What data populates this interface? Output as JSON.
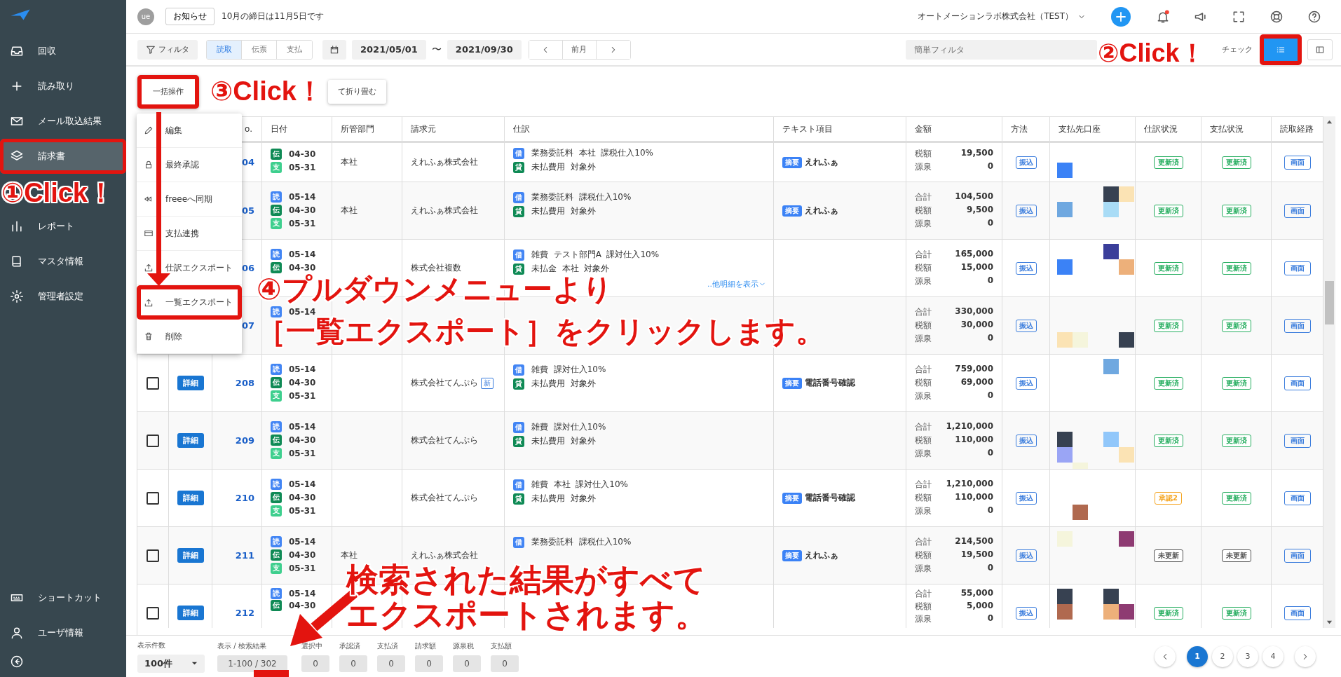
{
  "sidebar": {
    "items": [
      {
        "label": "回収",
        "selected": false,
        "highlighted": false
      },
      {
        "label": "読み取り",
        "selected": false,
        "highlighted": false
      },
      {
        "label": "メール取込結果",
        "selected": false,
        "highlighted": false
      },
      {
        "label": "請求書",
        "selected": true,
        "highlighted": true
      },
      {
        "label": "レポート",
        "selected": false,
        "highlighted": false
      },
      {
        "label": "マスタ情報",
        "selected": false,
        "highlighted": false
      },
      {
        "label": "管理者設定",
        "selected": false,
        "highlighted": false
      }
    ],
    "bottom_items": [
      {
        "label": "ショートカット"
      },
      {
        "label": "ユーザ情報"
      }
    ]
  },
  "topbar": {
    "avatar": "ue",
    "notice_button": "お知らせ",
    "notice": "10月の締日は11月5日です",
    "company": "オートメーションラボ株式会社（TEST）",
    "unread": true
  },
  "toolbar": {
    "filter_button": "フィルタ",
    "source_tabs": [
      {
        "label": "読取",
        "selected": true
      },
      {
        "label": "伝票",
        "selected": false
      },
      {
        "label": "支払",
        "selected": false
      }
    ],
    "date_from": "2021/05/01",
    "date_separator": "〜",
    "date_to": "2021/09/30",
    "month_button": "前月",
    "quick_filter": {
      "placeholder": "簡単フィルタ"
    },
    "check_button": "チェック",
    "view_toggles": [
      {
        "selected": true,
        "highlighted": true
      },
      {
        "selected": false,
        "highlighted": false
      }
    ]
  },
  "bulk_buttons": [
    {
      "label": "一括操作",
      "highlighted": true
    },
    {
      "label": "て折り畳む",
      "highlighted": false
    }
  ],
  "dropdown_menu": {
    "items": [
      {
        "label": "編集",
        "highlighted": false
      },
      {
        "label": "最終承認",
        "highlighted": false
      },
      {
        "label": "freeeへ同期",
        "highlighted": false
      },
      {
        "label": "支払連携",
        "highlighted": false
      },
      {
        "label": "仕訳エクスポート",
        "highlighted": false
      },
      {
        "label": "一覧エクスポート",
        "highlighted": true
      },
      {
        "label": "削除",
        "highlighted": false
      }
    ]
  },
  "table": {
    "columns": [
      "o.",
      "日付",
      "所管部門",
      "請求元",
      "仕訳",
      "テキスト項目",
      "金額",
      "方法",
      "支払先口座",
      "仕訳状況",
      "支払状況",
      "読取経路"
    ],
    "rows": [
      {
        "no": "04",
        "dates": [
          {
            "tag": "伝",
            "color": "#0f8a55",
            "date": "04-30"
          },
          {
            "tag": "支",
            "color": "#3ecf8e",
            "date": "05-31"
          }
        ],
        "dept": "本社",
        "client": "えれふぁ株式会社",
        "journal": [
          {
            "side": "借",
            "color": "#4285f4",
            "text": "業務委託料  本社  課税仕入10%"
          },
          {
            "side": "貸",
            "color": "#0f8a55",
            "text": "未払費用  対象外"
          }
        ],
        "summary": {
          "tag": "摘要",
          "text": "えれふぁ"
        },
        "amounts": [
          {
            "label": "税額",
            "value": "19,500"
          },
          {
            "label": "源泉",
            "value": "0"
          }
        ],
        "method": "振込",
        "journal_status": {
          "text": "更新済",
          "color": "#27ae60"
        },
        "pay_status": {
          "text": "更新済",
          "color": "#27ae60"
        },
        "route": "画面"
      },
      {
        "no": "05",
        "dates": [
          {
            "tag": "読",
            "color": "#4285f4",
            "date": "05-14"
          },
          {
            "tag": "伝",
            "color": "#0f8a55",
            "date": "04-30"
          },
          {
            "tag": "支",
            "color": "#3ecf8e",
            "date": "05-31"
          }
        ],
        "dept": "本社",
        "client": "えれふぁ株式会社",
        "journal": [
          {
            "side": "借",
            "color": "#4285f4",
            "text": "業務委託料  課税仕入10%"
          },
          {
            "side": "貸",
            "color": "#0f8a55",
            "text": "未払費用  対象外"
          }
        ],
        "summary": {
          "tag": "摘要",
          "text": "えれふぁ"
        },
        "amounts": [
          {
            "label": "合計",
            "value": "104,500"
          },
          {
            "label": "税額",
            "value": "9,500"
          },
          {
            "label": "源泉",
            "value": "0"
          }
        ],
        "method": "振込",
        "journal_status": {
          "text": "更新済",
          "color": "#27ae60"
        },
        "pay_status": {
          "text": "更新済",
          "color": "#27ae60"
        },
        "route": "画面"
      },
      {
        "no": "06",
        "dates": [
          {
            "tag": "読",
            "color": "#4285f4",
            "date": "05-14"
          },
          {
            "tag": "伝",
            "color": "#0f8a55",
            "date": "04-30"
          }
        ],
        "client": "株式会社複数",
        "journal": [
          {
            "side": "借",
            "color": "#4285f4",
            "text": "雑費  テスト部門A  課対仕入10%"
          },
          {
            "side": "貸",
            "color": "#0f8a55",
            "text": "未払金  本社  対象外"
          }
        ],
        "more_link": "..他明細を表示",
        "amounts": [
          {
            "label": "合計",
            "value": "165,000"
          },
          {
            "label": "税額",
            "value": "15,000"
          },
          {
            "label": "源泉",
            "value": "0"
          }
        ],
        "method": "振込",
        "journal_status": {
          "text": "更新済",
          "color": "#27ae60"
        },
        "pay_status": {
          "text": "更新済",
          "color": "#27ae60"
        },
        "route": "画面"
      },
      {
        "no": "07",
        "dates": [
          {
            "tag": "読",
            "color": "#4285f4",
            "date": "05-14"
          }
        ],
        "amounts": [
          {
            "label": "合計",
            "value": "330,000"
          },
          {
            "label": "税額",
            "value": "30,000"
          },
          {
            "label": "源泉",
            "value": "0"
          }
        ],
        "method": "振込",
        "journal_status": {
          "text": "更新済",
          "color": "#27ae60"
        },
        "pay_status": {
          "text": "更新済",
          "color": "#27ae60"
        },
        "route": "画面"
      },
      {
        "checked": false,
        "detail": "詳細",
        "no": "208",
        "dates": [
          {
            "tag": "読",
            "color": "#4285f4",
            "date": "05-14"
          },
          {
            "tag": "伝",
            "color": "#0f8a55",
            "date": "04-30"
          },
          {
            "tag": "支",
            "color": "#3ecf8e",
            "date": "05-31"
          }
        ],
        "client": "株式会社てんぷら",
        "client_badge": "新",
        "journal": [
          {
            "side": "借",
            "color": "#4285f4",
            "text": "雑費  課対仕入10%"
          },
          {
            "side": "貸",
            "color": "#0f8a55",
            "text": "未払費用  対象外"
          }
        ],
        "summary": {
          "tag": "摘要",
          "text": "電話番号確認"
        },
        "amounts": [
          {
            "label": "合計",
            "value": "759,000"
          },
          {
            "label": "税額",
            "value": "69,000"
          },
          {
            "label": "源泉",
            "value": "0"
          }
        ],
        "method": "振込",
        "journal_status": {
          "text": "更新済",
          "color": "#27ae60"
        },
        "pay_status": {
          "text": "更新済",
          "color": "#27ae60"
        },
        "route": "画面"
      },
      {
        "checked": false,
        "detail": "詳細",
        "no": "209",
        "dates": [
          {
            "tag": "読",
            "color": "#4285f4",
            "date": "05-14"
          },
          {
            "tag": "伝",
            "color": "#0f8a55",
            "date": "04-30"
          },
          {
            "tag": "支",
            "color": "#3ecf8e",
            "date": "05-31"
          }
        ],
        "client": "株式会社てんぷら",
        "journal": [
          {
            "side": "借",
            "color": "#4285f4",
            "text": "雑費  課対仕入10%"
          },
          {
            "side": "貸",
            "color": "#0f8a55",
            "text": "未払費用  対象外"
          }
        ],
        "amounts": [
          {
            "label": "合計",
            "value": "1,210,000"
          },
          {
            "label": "税額",
            "value": "110,000"
          },
          {
            "label": "源泉",
            "value": "0"
          }
        ],
        "method": "振込",
        "journal_status": {
          "text": "更新済",
          "color": "#27ae60"
        },
        "pay_status": {
          "text": "更新済",
          "color": "#27ae60"
        },
        "route": "画面"
      },
      {
        "checked": false,
        "detail": "詳細",
        "no": "210",
        "dates": [
          {
            "tag": "読",
            "color": "#4285f4",
            "date": "05-14"
          },
          {
            "tag": "伝",
            "color": "#0f8a55",
            "date": "04-30"
          },
          {
            "tag": "支",
            "color": "#3ecf8e",
            "date": "05-31"
          }
        ],
        "client": "株式会社てんぷら",
        "journal": [
          {
            "side": "借",
            "color": "#4285f4",
            "text": "雑費  本社  課対仕入10%"
          },
          {
            "side": "貸",
            "color": "#0f8a55",
            "text": "未払費用  対象外"
          }
        ],
        "summary": {
          "tag": "摘要",
          "text": "電話番号確認"
        },
        "amounts": [
          {
            "label": "合計",
            "value": "1,210,000"
          },
          {
            "label": "税額",
            "value": "110,000"
          },
          {
            "label": "源泉",
            "value": "0"
          }
        ],
        "method": "振込",
        "journal_status": {
          "text": "承認2",
          "color": "#f5a623"
        },
        "pay_status": {
          "text": "更新済",
          "color": "#27ae60"
        },
        "route": "画面"
      },
      {
        "checked": false,
        "detail": "詳細",
        "no": "211",
        "dates": [
          {
            "tag": "読",
            "color": "#4285f4",
            "date": "05-14"
          },
          {
            "tag": "伝",
            "color": "#0f8a55",
            "date": "04-30"
          },
          {
            "tag": "支",
            "color": "#3ecf8e",
            "date": "05-31"
          }
        ],
        "dept": "本社",
        "client": "えれふぁ株式会社",
        "journal": [
          {
            "side": "借",
            "color": "#4285f4",
            "text": "業務委託料  課税仕入10%"
          }
        ],
        "summary": {
          "tag": "摘要",
          "text": "えれふぁ"
        },
        "amounts": [
          {
            "label": "合計",
            "value": "214,500"
          },
          {
            "label": "税額",
            "value": "19,500"
          },
          {
            "label": "源泉",
            "value": "0"
          }
        ],
        "method": "振込",
        "journal_status": {
          "text": "未更新",
          "color": "#555555"
        },
        "pay_status": {
          "text": "未更新",
          "color": "#555555"
        },
        "route": "画面"
      },
      {
        "checked": false,
        "detail": "詳細",
        "no": "212",
        "dates": [
          {
            "tag": "読",
            "color": "#4285f4",
            "date": "05-14"
          },
          {
            "tag": "伝",
            "color": "#0f8a55",
            "date": "04-30"
          }
        ],
        "amounts": [
          {
            "label": "合計",
            "value": "55,000"
          },
          {
            "label": "税額",
            "value": "5,000"
          },
          {
            "label": "源泉",
            "value": "0"
          }
        ],
        "method": "振込",
        "journal_status": {
          "text": "更新済",
          "color": "#27ae60"
        },
        "pay_status": {
          "text": "更新済",
          "color": "#27ae60"
        },
        "route": "画面"
      }
    ]
  },
  "footer": {
    "page_size": {
      "label": "表示件数",
      "value": "100件"
    },
    "stats": [
      {
        "label": "表示 / 検索結果",
        "value": "1-100 / 302"
      },
      {
        "label": "選択中",
        "value": "0"
      },
      {
        "label": "承認済",
        "value": "0"
      },
      {
        "label": "支払済",
        "value": "0"
      },
      {
        "label": "請求額",
        "value": "0"
      },
      {
        "label": "源泉税",
        "value": "0"
      },
      {
        "label": "支払額",
        "value": "0"
      }
    ],
    "pages": [
      {
        "label": "1",
        "selected": true
      },
      {
        "label": "2",
        "selected": false
      },
      {
        "label": "3",
        "selected": false
      },
      {
        "label": "4",
        "selected": false
      }
    ]
  },
  "callouts": [
    {
      "lines": [
        "①Click！"
      ]
    },
    {
      "lines": [
        "②Click！"
      ]
    },
    {
      "lines": [
        "③Click！"
      ]
    },
    {
      "lines": [
        "④プルダウンメニューより",
        "［一覧エクスポート］をクリックします。"
      ]
    },
    {
      "lines": [
        "検索された結果がすべて",
        "エクスポートされます。"
      ]
    }
  ]
}
